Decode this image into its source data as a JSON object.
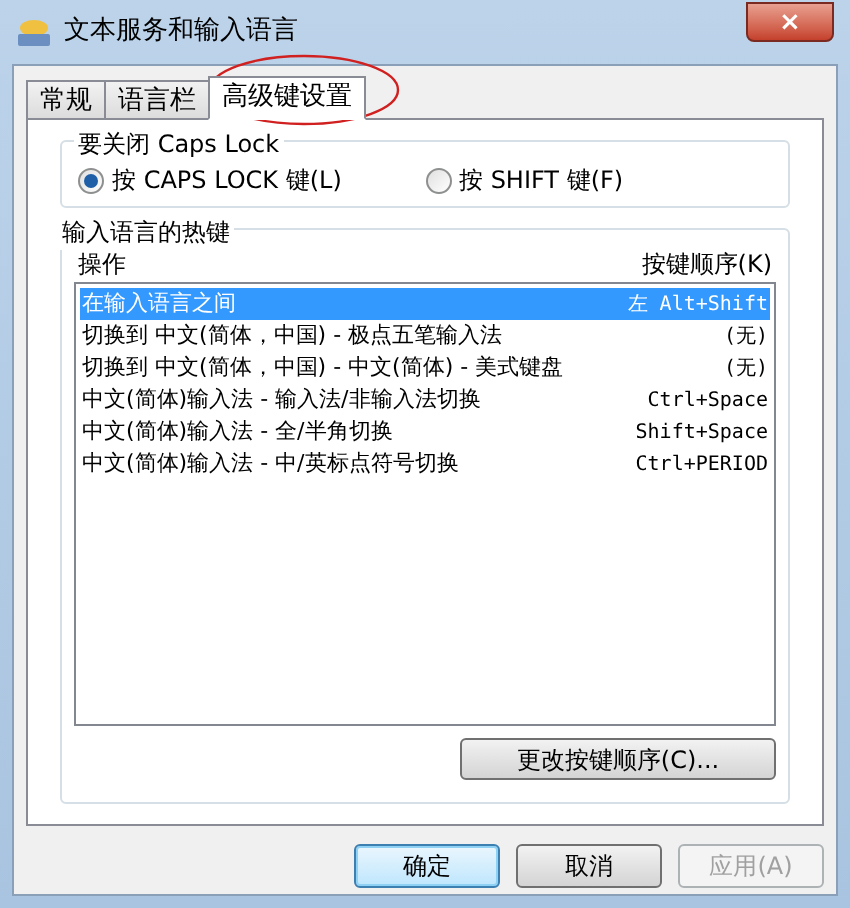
{
  "window": {
    "title": "文本服务和输入语言",
    "close": "×"
  },
  "tabs": [
    {
      "label": "常规",
      "selected": false
    },
    {
      "label": "语言栏",
      "selected": false
    },
    {
      "label": "高级键设置",
      "selected": true
    }
  ],
  "caps_lock": {
    "title": "要关闭 Caps Lock",
    "options": [
      {
        "label": "按 CAPS LOCK 键(L)",
        "selected": true
      },
      {
        "label": "按 SHIFT 键(F)",
        "selected": false
      }
    ]
  },
  "hotkeys": {
    "title": "输入语言的热键",
    "columns": [
      "操作",
      "按键顺序(K)"
    ],
    "rows": [
      {
        "action": "在输入语言之间",
        "keys": "左 Alt+Shift",
        "selected": true
      },
      {
        "action": "切换到 中文(简体，中国) - 极点五笔输入法",
        "keys": "(无)",
        "selected": false
      },
      {
        "action": "切换到 中文(简体，中国) - 中文(简体) - 美式键盘",
        "keys": "(无)",
        "selected": false
      },
      {
        "action": "中文(简体)输入法 - 输入法/非输入法切换",
        "keys": "Ctrl+Space",
        "selected": false
      },
      {
        "action": "中文(简体)输入法 - 全/半角切换",
        "keys": "Shift+Space",
        "selected": false
      },
      {
        "action": "中文(简体)输入法 - 中/英标点符号切换",
        "keys": "Ctrl+PERIOD",
        "selected": false
      }
    ],
    "change_button": "更改按键顺序(C)..."
  },
  "buttons": [
    {
      "label": "确定",
      "kind": "default",
      "disabled": false
    },
    {
      "label": "取消",
      "kind": "normal",
      "disabled": false
    },
    {
      "label": "应用(A)",
      "kind": "normal",
      "disabled": true
    }
  ]
}
